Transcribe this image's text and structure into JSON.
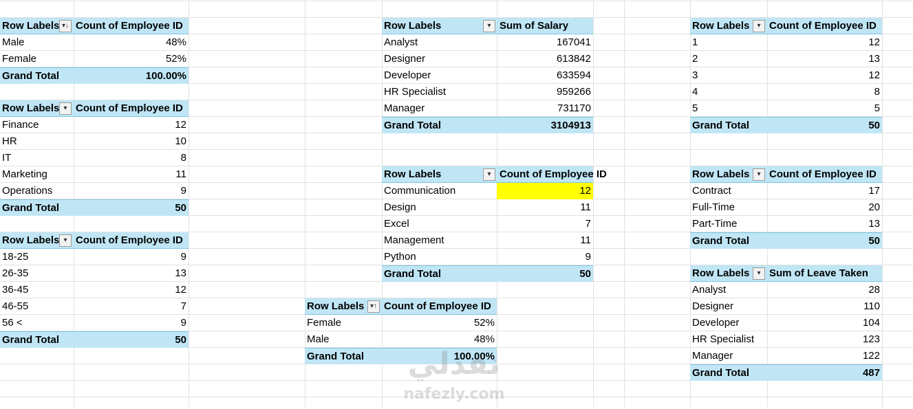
{
  "pivots": {
    "gender": {
      "header": {
        "row_label": "Row Labels",
        "value_label": "Count of Employee ID",
        "sort_icon": "sort-descending-icon"
      },
      "rows": [
        {
          "label": "Male",
          "value": "48%"
        },
        {
          "label": "Female",
          "value": "52%"
        }
      ],
      "total": {
        "label": "Grand Total",
        "value": "100.00%"
      }
    },
    "department": {
      "header": {
        "row_label": "Row Labels",
        "value_label": "Count of Employee ID",
        "sort_icon": "dropdown-icon"
      },
      "rows": [
        {
          "label": "Finance",
          "value": "12"
        },
        {
          "label": "HR",
          "value": "10"
        },
        {
          "label": "IT",
          "value": "8"
        },
        {
          "label": "Marketing",
          "value": "11"
        },
        {
          "label": "Operations",
          "value": "9"
        }
      ],
      "total": {
        "label": "Grand Total",
        "value": "50"
      }
    },
    "age": {
      "header": {
        "row_label": "Row Labels",
        "value_label": "Count of Employee ID",
        "sort_icon": "dropdown-icon"
      },
      "rows": [
        {
          "label": "18-25",
          "value": "9"
        },
        {
          "label": "26-35",
          "value": "13"
        },
        {
          "label": "36-45",
          "value": "12"
        },
        {
          "label": "46-55",
          "value": "7"
        },
        {
          "label": "56 <",
          "value": "9"
        }
      ],
      "total": {
        "label": "Grand Total",
        "value": "50"
      }
    },
    "salary": {
      "header": {
        "row_label": "Row Labels",
        "value_label": "Sum of Salary",
        "sort_icon": "dropdown-icon"
      },
      "rows": [
        {
          "label": "Analyst",
          "value": "167041"
        },
        {
          "label": "Designer",
          "value": "613842"
        },
        {
          "label": "Developer",
          "value": "633594"
        },
        {
          "label": "HR Specialist",
          "value": "959266"
        },
        {
          "label": "Manager",
          "value": "731170"
        }
      ],
      "total": {
        "label": "Grand Total",
        "value": "3104913"
      }
    },
    "skills": {
      "header": {
        "row_label": "Row Labels",
        "value_label": "Count of Employee ID",
        "sort_icon": "dropdown-icon"
      },
      "rows": [
        {
          "label": "Communication",
          "value": "12"
        },
        {
          "label": "Design",
          "value": "11"
        },
        {
          "label": "Excel",
          "value": "7"
        },
        {
          "label": "Management",
          "value": "11"
        },
        {
          "label": "Python",
          "value": "9"
        }
      ],
      "total": {
        "label": "Grand Total",
        "value": "50"
      },
      "highlight_color": "#ffff00"
    },
    "gender2": {
      "header": {
        "row_label": "Row Labels",
        "value_label": "Count of Employee ID",
        "sort_icon": "sort-ascending-icon"
      },
      "rows": [
        {
          "label": "Female",
          "value": "52%"
        },
        {
          "label": "Male",
          "value": "48%"
        }
      ],
      "total": {
        "label": "Grand Total",
        "value": "100.00%"
      }
    },
    "rating": {
      "header": {
        "row_label": "Row Labels",
        "value_label": "Count of Employee ID",
        "sort_icon": "dropdown-icon"
      },
      "rows": [
        {
          "label": "1",
          "value": "12"
        },
        {
          "label": "2",
          "value": "13"
        },
        {
          "label": "3",
          "value": "12"
        },
        {
          "label": "4",
          "value": "8"
        },
        {
          "label": "5",
          "value": "5"
        }
      ],
      "total": {
        "label": "Grand Total",
        "value": "50"
      }
    },
    "employment": {
      "header": {
        "row_label": "Row Labels",
        "value_label": "Count of Employee ID",
        "sort_icon": "dropdown-icon"
      },
      "rows": [
        {
          "label": "Contract",
          "value": "17"
        },
        {
          "label": "Full-Time",
          "value": "20"
        },
        {
          "label": "Part-Time",
          "value": "13"
        }
      ],
      "total": {
        "label": "Grand Total",
        "value": "50"
      }
    },
    "leave": {
      "header": {
        "row_label": "Row Labels",
        "value_label": "Sum of Leave Taken",
        "sort_icon": "dropdown-icon"
      },
      "rows": [
        {
          "label": "Analyst",
          "value": "28"
        },
        {
          "label": "Designer",
          "value": "110"
        },
        {
          "label": "Developer",
          "value": "104"
        },
        {
          "label": "HR Specialist",
          "value": "123"
        },
        {
          "label": "Manager",
          "value": "122"
        }
      ],
      "total": {
        "label": "Grand Total",
        "value": "487"
      }
    }
  },
  "watermark": {
    "arabic": "نفذلي",
    "latin": "nafezly.com"
  },
  "colors": {
    "pivot_header_bg": "#c0e6f5",
    "pivot_border": "#7fc7e0",
    "gridline": "#e1e1e1",
    "highlight": "#ffff00"
  }
}
